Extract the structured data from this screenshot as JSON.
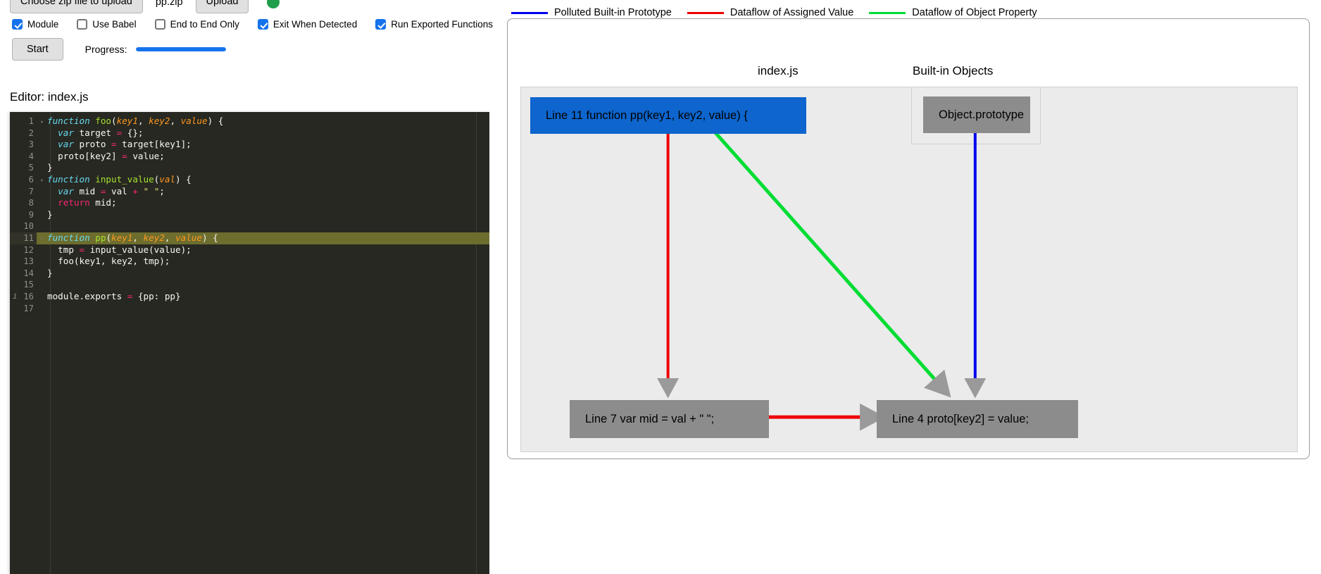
{
  "toolbar": {
    "choose_file_label": "Choose zip file to upload",
    "file_name": "pp.zip",
    "upload_label": "Upload",
    "status_dot_color": "#1e9e4a",
    "checkboxes": [
      {
        "label": "Module",
        "checked": true
      },
      {
        "label": "Use Babel",
        "checked": false
      },
      {
        "label": "End to End Only",
        "checked": false
      },
      {
        "label": "Exit When Detected",
        "checked": true
      },
      {
        "label": "Run Exported Functions",
        "checked": true
      }
    ],
    "start_label": "Start",
    "progress_label": "Progress:",
    "progress_percent": 100,
    "progress_color": "#1672ec"
  },
  "editor": {
    "title": "Editor: index.js",
    "highlight_line": 11,
    "lines": [
      {
        "n": 1,
        "fold": true,
        "gutter_mark": "",
        "tokens": [
          {
            "t": "function",
            "c": "kw"
          },
          {
            "t": " ",
            "c": "pun"
          },
          {
            "t": "foo",
            "c": "fn"
          },
          {
            "t": "(",
            "c": "pun"
          },
          {
            "t": "key1",
            "c": "par"
          },
          {
            "t": ", ",
            "c": "pun"
          },
          {
            "t": "key2",
            "c": "par"
          },
          {
            "t": ", ",
            "c": "pun"
          },
          {
            "t": "value",
            "c": "par"
          },
          {
            "t": ") {",
            "c": "pun"
          }
        ]
      },
      {
        "n": 2,
        "fold": false,
        "gutter_mark": "",
        "tokens": [
          {
            "t": "  ",
            "c": "pun"
          },
          {
            "t": "var",
            "c": "kw"
          },
          {
            "t": " target ",
            "c": "code-txt"
          },
          {
            "t": "=",
            "c": "op"
          },
          {
            "t": " {};",
            "c": "code-txt"
          }
        ]
      },
      {
        "n": 3,
        "fold": false,
        "gutter_mark": "",
        "tokens": [
          {
            "t": "  ",
            "c": "pun"
          },
          {
            "t": "var",
            "c": "kw"
          },
          {
            "t": " proto ",
            "c": "code-txt"
          },
          {
            "t": "=",
            "c": "op"
          },
          {
            "t": " target[key1];",
            "c": "code-txt"
          }
        ]
      },
      {
        "n": 4,
        "fold": false,
        "gutter_mark": "",
        "tokens": [
          {
            "t": "  proto[key2] ",
            "c": "code-txt"
          },
          {
            "t": "=",
            "c": "op"
          },
          {
            "t": " value;",
            "c": "code-txt"
          }
        ]
      },
      {
        "n": 5,
        "fold": false,
        "gutter_mark": "",
        "tokens": [
          {
            "t": "}",
            "c": "code-txt"
          }
        ]
      },
      {
        "n": 6,
        "fold": true,
        "gutter_mark": "",
        "tokens": [
          {
            "t": "function",
            "c": "kw"
          },
          {
            "t": " ",
            "c": "pun"
          },
          {
            "t": "input_value",
            "c": "fn"
          },
          {
            "t": "(",
            "c": "pun"
          },
          {
            "t": "val",
            "c": "par"
          },
          {
            "t": ") {",
            "c": "pun"
          }
        ]
      },
      {
        "n": 7,
        "fold": false,
        "gutter_mark": "",
        "tokens": [
          {
            "t": "  ",
            "c": "pun"
          },
          {
            "t": "var",
            "c": "kw"
          },
          {
            "t": " mid ",
            "c": "code-txt"
          },
          {
            "t": "=",
            "c": "op"
          },
          {
            "t": " val ",
            "c": "code-txt"
          },
          {
            "t": "+",
            "c": "op"
          },
          {
            "t": " ",
            "c": "code-txt"
          },
          {
            "t": "\" \"",
            "c": "str"
          },
          {
            "t": ";",
            "c": "code-txt"
          }
        ]
      },
      {
        "n": 8,
        "fold": false,
        "gutter_mark": "",
        "tokens": [
          {
            "t": "  ",
            "c": "pun"
          },
          {
            "t": "return",
            "c": "ret"
          },
          {
            "t": " mid;",
            "c": "code-txt"
          }
        ]
      },
      {
        "n": 9,
        "fold": false,
        "gutter_mark": "",
        "tokens": [
          {
            "t": "}",
            "c": "code-txt"
          }
        ]
      },
      {
        "n": 10,
        "fold": false,
        "gutter_mark": "",
        "tokens": [
          {
            "t": "",
            "c": "code-txt"
          }
        ]
      },
      {
        "n": 11,
        "fold": true,
        "gutter_mark": "",
        "tokens": [
          {
            "t": "function",
            "c": "kw"
          },
          {
            "t": " ",
            "c": "pun"
          },
          {
            "t": "pp",
            "c": "fn"
          },
          {
            "t": "(",
            "c": "pun"
          },
          {
            "t": "key1",
            "c": "par"
          },
          {
            "t": ", ",
            "c": "pun"
          },
          {
            "t": "key2",
            "c": "par"
          },
          {
            "t": ", ",
            "c": "pun"
          },
          {
            "t": "value",
            "c": "par"
          },
          {
            "t": ") {",
            "c": "pun"
          }
        ]
      },
      {
        "n": 12,
        "fold": false,
        "gutter_mark": "",
        "tokens": [
          {
            "t": "  tmp ",
            "c": "code-txt"
          },
          {
            "t": "=",
            "c": "op"
          },
          {
            "t": " input_value(value);",
            "c": "code-txt"
          }
        ]
      },
      {
        "n": 13,
        "fold": false,
        "gutter_mark": "",
        "tokens": [
          {
            "t": "  foo(key1, key2, tmp);",
            "c": "code-txt"
          }
        ]
      },
      {
        "n": 14,
        "fold": false,
        "gutter_mark": "",
        "tokens": [
          {
            "t": "}",
            "c": "code-txt"
          }
        ]
      },
      {
        "n": 15,
        "fold": false,
        "gutter_mark": "",
        "tokens": [
          {
            "t": "",
            "c": "code-txt"
          }
        ]
      },
      {
        "n": 16,
        "fold": false,
        "gutter_mark": "i",
        "tokens": [
          {
            "t": "module.exports ",
            "c": "code-txt"
          },
          {
            "t": "=",
            "c": "op"
          },
          {
            "t": " {pp: pp}",
            "c": "code-txt"
          }
        ]
      },
      {
        "n": 17,
        "fold": false,
        "gutter_mark": "",
        "tokens": [
          {
            "t": "",
            "c": "code-txt"
          }
        ]
      }
    ]
  },
  "graph": {
    "legend": [
      {
        "label": "Polluted Built-in Prototype",
        "color": "#0000ee"
      },
      {
        "label": "Dataflow of Assigned Value",
        "color": "#ee0000"
      },
      {
        "label": "Dataflow of Object Property",
        "color": "#00dd33"
      }
    ],
    "clusters": [
      {
        "id": "index-js",
        "caption": "index.js"
      },
      {
        "id": "builtin-objects",
        "caption": "Built-in Objects"
      }
    ],
    "nodes": [
      {
        "id": "n-pp",
        "label": "Line 11 function pp(key1, key2, value) {",
        "color": "#0d65cd",
        "cluster": "index-js"
      },
      {
        "id": "n-proto",
        "label": "Object.prototype",
        "color": "#8c8c8c",
        "cluster": "builtin-objects"
      },
      {
        "id": "n-mid",
        "label": "Line 7   var mid = val + \" \";",
        "color": "#8c8c8c",
        "cluster": "index-js"
      },
      {
        "id": "n-assign",
        "label": "Line 4   proto[key2] = value;",
        "color": "#8c8c8c",
        "cluster": "index-js"
      }
    ],
    "edges": [
      {
        "from": "n-pp",
        "to": "n-mid",
        "color": "#ee0000",
        "kind": "Dataflow of Assigned Value"
      },
      {
        "from": "n-pp",
        "to": "n-assign",
        "color": "#00dd33",
        "kind": "Dataflow of Object Property"
      },
      {
        "from": "n-proto",
        "to": "n-assign",
        "color": "#0000ee",
        "kind": "Polluted Built-in Prototype"
      },
      {
        "from": "n-mid",
        "to": "n-assign",
        "color": "#ee0000",
        "kind": "Dataflow of Assigned Value"
      }
    ]
  }
}
